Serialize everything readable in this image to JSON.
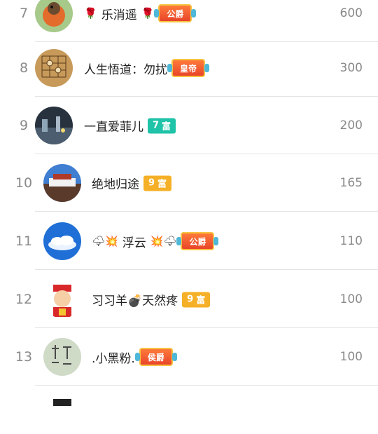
{
  "rows": [
    {
      "rank": "7",
      "name": "乐消遥",
      "emoji_left": "🌹",
      "emoji_right": "🌹",
      "badge_type": "noble",
      "badge_label": "公爵",
      "score": "600"
    },
    {
      "rank": "8",
      "name": "人生悟道：勿扰",
      "badge_type": "noble",
      "badge_label": "皇帝",
      "score": "300"
    },
    {
      "rank": "9",
      "name": "一直爱菲儿",
      "badge_type": "rich",
      "badge_num": "7",
      "badge_label": "富",
      "badge_color": "#1fc3a8",
      "score": "200"
    },
    {
      "rank": "10",
      "name": "绝地归途",
      "badge_type": "rich",
      "badge_num": "9",
      "badge_label": "富",
      "badge_color": "#f5b027",
      "score": "165"
    },
    {
      "rank": "11",
      "name": "浮云",
      "emoji_left": "🌩💥",
      "emoji_right": "💥🌩",
      "badge_type": "noble",
      "badge_label": "公爵",
      "score": "110"
    },
    {
      "rank": "12",
      "name": "习习羊💣天然疼",
      "badge_type": "rich",
      "badge_num": "9",
      "badge_label": "富",
      "badge_color": "#f5b027",
      "score": "100"
    },
    {
      "rank": "13",
      "name": ".小黑粉.",
      "badge_type": "noble",
      "badge_label": "侯爵",
      "score": "100"
    }
  ]
}
